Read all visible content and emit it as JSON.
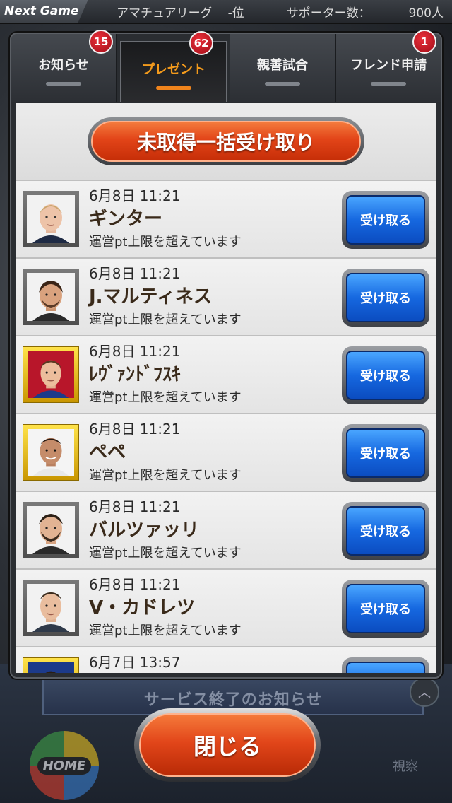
{
  "topbar": {
    "next_game": "Next Game",
    "league": "アマチュアリーグ",
    "rank": "-位",
    "supporters_label": "サポーター数：",
    "supporters_value": "900人"
  },
  "background": {
    "banner_text": "サービス終了のお知らせ",
    "home_label": "HOME",
    "view_label": "視察"
  },
  "tabs": [
    {
      "label": "お知らせ",
      "badge": "15",
      "active": false
    },
    {
      "label": "プレゼント",
      "badge": "62",
      "active": true
    },
    {
      "label": "親善試合",
      "badge": "",
      "active": false
    },
    {
      "label": "フレンド申請",
      "badge": "1",
      "active": false
    }
  ],
  "bulk_button": "未取得一括受け取り",
  "items": [
    {
      "date": "6月8日 11:21",
      "name": "ギンター",
      "note": "運営pt上限を超えています",
      "button": "受け取る",
      "frame": "normal"
    },
    {
      "date": "6月8日 11:21",
      "name": "J.マルティネス",
      "note": "運営pt上限を超えています",
      "button": "受け取る",
      "frame": "normal"
    },
    {
      "date": "6月8日 11:21",
      "name": "ﾚｳﾞｧﾝﾄﾞﾌｽｷ",
      "note": "運営pt上限を超えています",
      "button": "受け取る",
      "frame": "gold"
    },
    {
      "date": "6月8日 11:21",
      "name": "ペペ",
      "note": "運営pt上限を超えています",
      "button": "受け取る",
      "frame": "gold"
    },
    {
      "date": "6月8日 11:21",
      "name": "バルツァッリ",
      "note": "運営pt上限を超えています",
      "button": "受け取る",
      "frame": "normal"
    },
    {
      "date": "6月8日 11:21",
      "name": "V・カドレツ",
      "note": "運営pt上限を超えています",
      "button": "受け取る",
      "frame": "normal"
    },
    {
      "date": "6月7日 13:57",
      "name": "",
      "note": "",
      "button": "",
      "frame": "gold"
    }
  ],
  "close_button": "閉じる",
  "colors": {
    "accent_orange": "#e24418",
    "tab_active": "#f39a1c",
    "receive_blue": "#1668e0",
    "badge_red": "#c8141e"
  }
}
